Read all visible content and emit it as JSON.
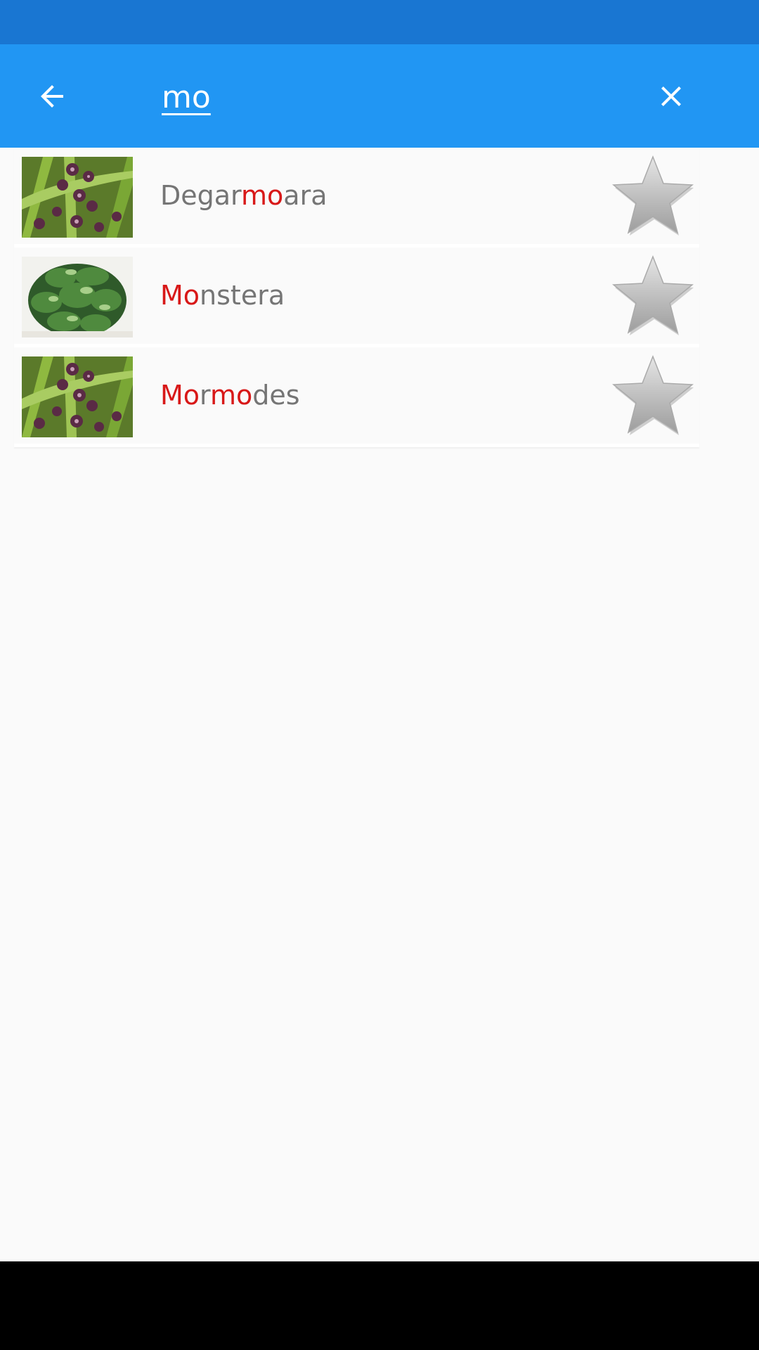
{
  "colors": {
    "status_bar": "#1976d2",
    "app_bar": "#2196f3",
    "highlight": "#d81818",
    "text_secondary": "#757575",
    "background": "#fafafa"
  },
  "header": {
    "back_icon": "arrow-left-icon",
    "search_value": "mo",
    "clear_icon": "close-icon"
  },
  "results": [
    {
      "name": "Degarmoara",
      "name_parts": [
        "Degar",
        "mo",
        "ara"
      ],
      "thumbnail": "orchid-thumbnail",
      "favorite_icon": "star-icon"
    },
    {
      "name": "Monstera",
      "name_parts": [
        "",
        "Mo",
        "nstera"
      ],
      "thumbnail": "monstera-thumbnail",
      "favorite_icon": "star-icon"
    },
    {
      "name": "Mormodes",
      "name_parts": [
        "",
        "Mo",
        "r",
        "mo",
        "des"
      ],
      "thumbnail": "orchid-thumbnail",
      "favorite_icon": "star-icon"
    }
  ]
}
